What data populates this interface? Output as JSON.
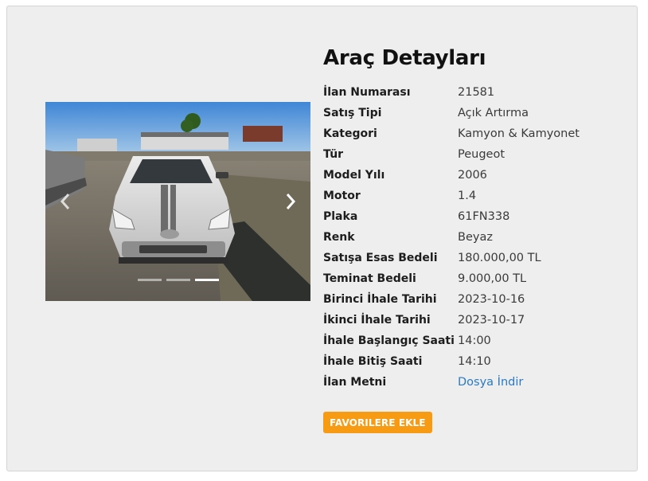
{
  "details": {
    "title": "Araç Detayları",
    "rows": [
      {
        "label": "İlan Numarası",
        "value": "21581"
      },
      {
        "label": "Satış Tipi",
        "value": "Açık Artırma"
      },
      {
        "label": "Kategori",
        "value": "Kamyon & Kamyonet"
      },
      {
        "label": "Tür",
        "value": "Peugeot"
      },
      {
        "label": "Model Yılı",
        "value": "2006"
      },
      {
        "label": "Motor",
        "value": "1.4"
      },
      {
        "label": "Plaka",
        "value": "61FN338"
      },
      {
        "label": "Renk",
        "value": "Beyaz"
      },
      {
        "label": "Satışa Esas Bedeli",
        "value": "180.000,00 TL"
      },
      {
        "label": "Teminat Bedeli",
        "value": "9.000,00 TL"
      },
      {
        "label": "Birinci İhale Tarihi",
        "value": "2023-10-16"
      },
      {
        "label": "İkinci İhale Tarihi",
        "value": "2023-10-17"
      },
      {
        "label": "İhale Başlangıç Saati",
        "value": "14:00"
      },
      {
        "label": "İhale Bitiş Saati",
        "value": "14:10"
      },
      {
        "label": "İlan Metni",
        "value": "Dosya İndir",
        "link": true
      }
    ],
    "favorite_button": "FAVORILERE EKLE"
  },
  "carousel": {
    "slide_count": 3,
    "active_index": 2,
    "prev_icon": "chevron-left-icon",
    "next_icon": "chevron-right-icon"
  },
  "colors": {
    "accent": "#f79a14",
    "link": "#2a7ac4",
    "panel": "#eeeeee"
  }
}
